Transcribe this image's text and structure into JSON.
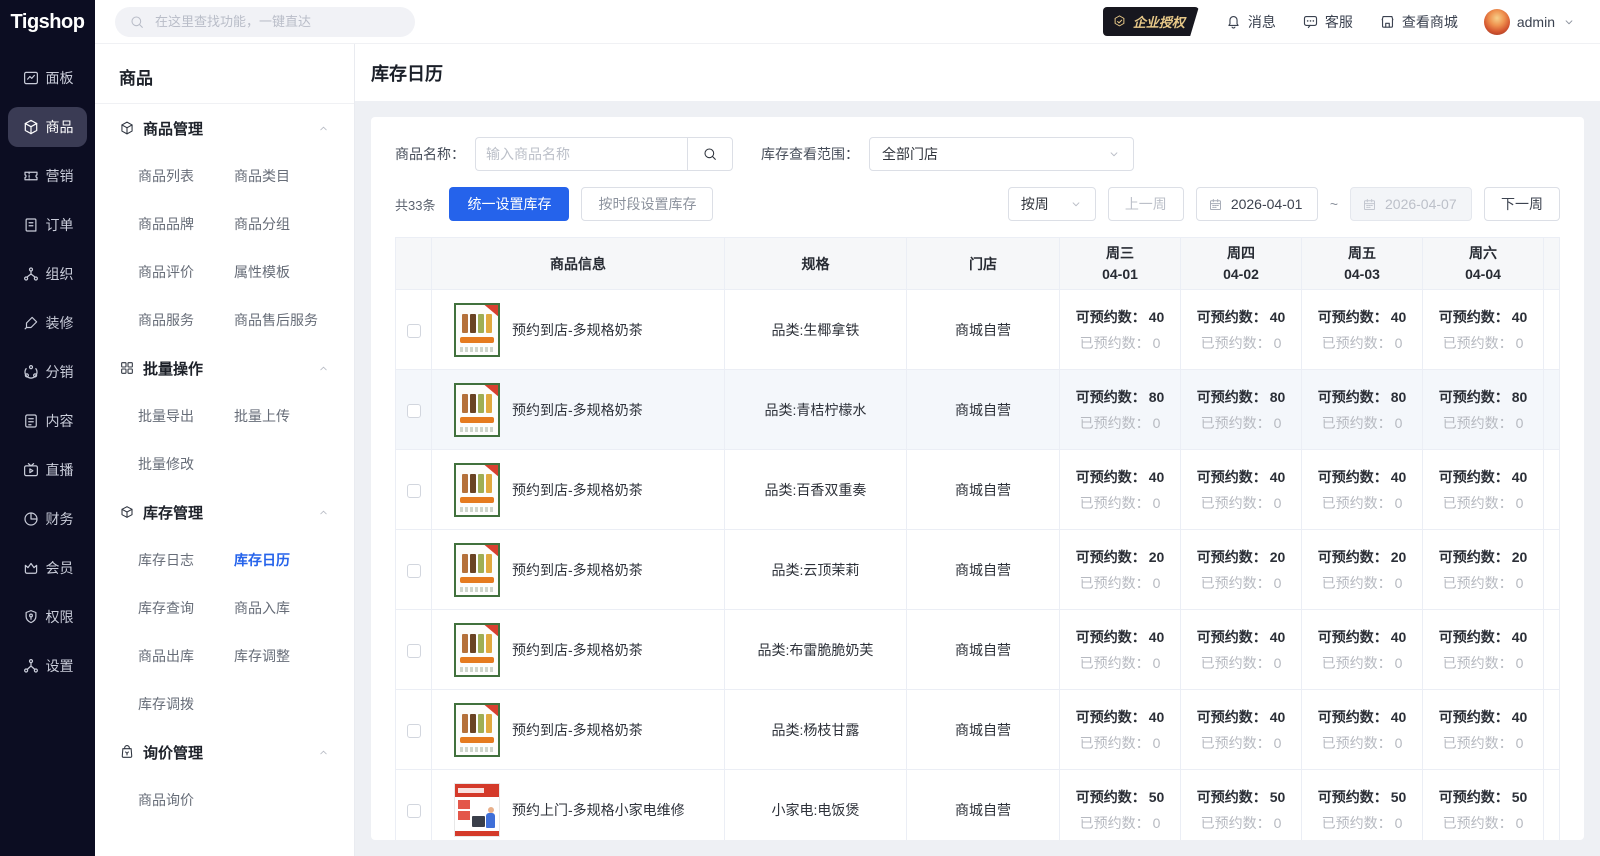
{
  "colors": {
    "accent": "#2563eb",
    "sidebar_bg": "#0c0d22",
    "sidebar_active_bg": "#3a3b54",
    "page_bg": "#eef0f4",
    "table_header_bg": "#f6f7f9",
    "table_border": "#ebeef5"
  },
  "topbar": {
    "logo": "Tigshop",
    "search_placeholder": "在这里查找功能，一键直达",
    "license_badge": "企业授权",
    "messages": "消息",
    "support": "客服",
    "view_mall": "查看商城",
    "username": "admin"
  },
  "sidebar": {
    "items": [
      {
        "label": "面板",
        "icon": "dashboard",
        "active": false
      },
      {
        "label": "商品",
        "icon": "goods",
        "active": true
      },
      {
        "label": "营销",
        "icon": "marketing",
        "active": false
      },
      {
        "label": "订单",
        "icon": "orders",
        "active": false
      },
      {
        "label": "组织",
        "icon": "org",
        "active": false
      },
      {
        "label": "装修",
        "icon": "deco",
        "active": false
      },
      {
        "label": "分销",
        "icon": "dist",
        "active": false
      },
      {
        "label": "内容",
        "icon": "content",
        "active": false
      },
      {
        "label": "直播",
        "icon": "live",
        "active": false
      },
      {
        "label": "财务",
        "icon": "finance",
        "active": false
      },
      {
        "label": "会员",
        "icon": "member",
        "active": false
      },
      {
        "label": "权限",
        "icon": "auth",
        "active": false
      },
      {
        "label": "设置",
        "icon": "settings",
        "active": false
      }
    ]
  },
  "submenu": {
    "title": "商品",
    "sections": [
      {
        "icon": "goods",
        "label": "商品管理",
        "items": [
          "商品列表",
          "商品类目",
          "商品品牌",
          "商品分组",
          "商品评价",
          "属性模板",
          "商品服务",
          "商品售后服务"
        ]
      },
      {
        "icon": "grid",
        "label": "批量操作",
        "items": [
          "批量导出",
          "批量上传",
          "批量修改"
        ]
      },
      {
        "icon": "stock",
        "label": "库存管理",
        "active_item": "库存日历",
        "items": [
          "库存日志",
          "库存日历",
          "库存查询",
          "商品入库",
          "商品出库",
          "库存调整",
          "库存调拨"
        ]
      },
      {
        "icon": "inquiry",
        "label": "询价管理",
        "items": [
          "商品询价"
        ]
      }
    ]
  },
  "page": {
    "title": "库存日历",
    "filters": {
      "product_name_label": "商品名称：",
      "product_name_placeholder": "输入商品名称",
      "scope_label": "库存查看范围：",
      "scope_value": "全部门店"
    },
    "toolbar": {
      "total_count": "共33条",
      "set_stock_button": "统一设置库存",
      "set_stock_by_period_button": "按时段设置库存",
      "period_select": "按周",
      "prev_week_button": "上一周",
      "date_start": "2026-04-01",
      "date_separator": "~",
      "date_end": "2026-04-07",
      "next_week_button": "下一周"
    },
    "table": {
      "columns": [
        "商品信息",
        "规格",
        "门店"
      ],
      "day_columns": [
        {
          "weekday": "周三",
          "date": "04-01"
        },
        {
          "weekday": "周四",
          "date": "04-02"
        },
        {
          "weekday": "周五",
          "date": "04-03"
        },
        {
          "weekday": "周六",
          "date": "04-04"
        }
      ],
      "available_label": "可预约数：",
      "booked_label": "已预约数：",
      "rows": [
        {
          "name": "预约到店-多规格奶茶",
          "spec": "品类:生椰拿铁",
          "store": "商城自营",
          "thumb": "tea",
          "highlighted": false,
          "days": [
            {
              "available": "40",
              "booked": "0"
            },
            {
              "available": "40",
              "booked": "0"
            },
            {
              "available": "40",
              "booked": "0"
            },
            {
              "available": "40",
              "booked": "0"
            }
          ]
        },
        {
          "name": "预约到店-多规格奶茶",
          "spec": "品类:青桔柠檬水",
          "store": "商城自营",
          "thumb": "tea",
          "highlighted": true,
          "days": [
            {
              "available": "80",
              "booked": "0"
            },
            {
              "available": "80",
              "booked": "0"
            },
            {
              "available": "80",
              "booked": "0"
            },
            {
              "available": "80",
              "booked": "0"
            }
          ]
        },
        {
          "name": "预约到店-多规格奶茶",
          "spec": "品类:百香双重奏",
          "store": "商城自营",
          "thumb": "tea",
          "highlighted": false,
          "days": [
            {
              "available": "40",
              "booked": "0"
            },
            {
              "available": "40",
              "booked": "0"
            },
            {
              "available": "40",
              "booked": "0"
            },
            {
              "available": "40",
              "booked": "0"
            }
          ]
        },
        {
          "name": "预约到店-多规格奶茶",
          "spec": "品类:云顶茉莉",
          "store": "商城自营",
          "thumb": "tea",
          "highlighted": false,
          "days": [
            {
              "available": "20",
              "booked": "0"
            },
            {
              "available": "20",
              "booked": "0"
            },
            {
              "available": "20",
              "booked": "0"
            },
            {
              "available": "20",
              "booked": "0"
            }
          ]
        },
        {
          "name": "预约到店-多规格奶茶",
          "spec": "品类:布雷脆脆奶芙",
          "store": "商城自营",
          "thumb": "tea",
          "highlighted": false,
          "days": [
            {
              "available": "40",
              "booked": "0"
            },
            {
              "available": "40",
              "booked": "0"
            },
            {
              "available": "40",
              "booked": "0"
            },
            {
              "available": "40",
              "booked": "0"
            }
          ]
        },
        {
          "name": "预约到店-多规格奶茶",
          "spec": "品类:杨枝甘露",
          "store": "商城自营",
          "thumb": "tea",
          "highlighted": false,
          "days": [
            {
              "available": "40",
              "booked": "0"
            },
            {
              "available": "40",
              "booked": "0"
            },
            {
              "available": "40",
              "booked": "0"
            },
            {
              "available": "40",
              "booked": "0"
            }
          ]
        },
        {
          "name": "预约上门-多规格小家电维修",
          "spec": "小家电:电饭煲",
          "store": "商城自营",
          "thumb": "appliance",
          "highlighted": false,
          "days": [
            {
              "available": "50",
              "booked": "0"
            },
            {
              "available": "50",
              "booked": "0"
            },
            {
              "available": "50",
              "booked": "0"
            },
            {
              "available": "50",
              "booked": "0"
            }
          ]
        }
      ]
    }
  }
}
